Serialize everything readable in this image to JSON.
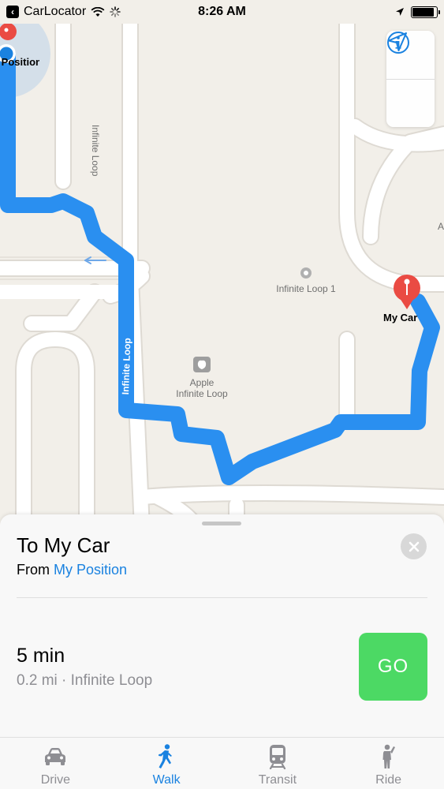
{
  "status_bar": {
    "back_app": "CarLocator",
    "time": "8:26 AM",
    "battery_level": 0.9
  },
  "map": {
    "street_names": [
      "Infinite Loop",
      "Infinite Loop"
    ],
    "poi_1": "Infinite Loop 1",
    "poi_2_line1": "Apple",
    "poi_2_line2": "Infinite Loop",
    "start_label": "My Position",
    "destination_label": "My Car",
    "edge_label": "A",
    "colors": {
      "route": "#2a8ff0",
      "pin": "#ea4b43",
      "user_dot": "#1a82e0",
      "land": "#f2efe9",
      "road": "#ffffff"
    }
  },
  "card": {
    "title": "To My Car",
    "from_prefix": "From",
    "from_place": "My Position",
    "duration": "5 min",
    "details": "0.2 mi · Infinite Loop",
    "go_label": "GO",
    "go_color": "#4cd964"
  },
  "tabs": [
    {
      "label": "Drive",
      "icon": "car-icon",
      "active": false
    },
    {
      "label": "Walk",
      "icon": "walk-icon",
      "active": true
    },
    {
      "label": "Transit",
      "icon": "train-icon",
      "active": false
    },
    {
      "label": "Ride",
      "icon": "ride-icon",
      "active": false
    }
  ]
}
